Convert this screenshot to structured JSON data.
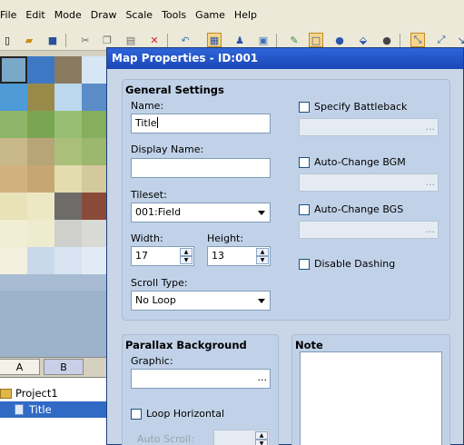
{
  "menu": [
    "File",
    "Edit",
    "Mode",
    "Draw",
    "Scale",
    "Tools",
    "Game",
    "Help"
  ],
  "palette": {
    "tabs": [
      "A",
      "B"
    ]
  },
  "tree": {
    "project": "Project1",
    "map": "Title"
  },
  "dialog": {
    "title": "Map Properties - ID:001",
    "general": {
      "title": "General Settings",
      "name_label": "Name:",
      "name_value": "Title",
      "display_name_label": "Display Name:",
      "display_name_value": "",
      "tileset_label": "Tileset:",
      "tileset_value": "001:Field",
      "width_label": "Width:",
      "width_value": "17",
      "height_label": "Height:",
      "height_value": "13",
      "scroll_type_label": "Scroll Type:",
      "scroll_type_value": "No Loop",
      "specify_battleback": "Specify Battleback",
      "auto_change_bgm": "Auto-Change BGM",
      "auto_change_bgs": "Auto-Change BGS",
      "disable_dashing": "Disable Dashing",
      "ellipsis": "..."
    },
    "parallax": {
      "title": "Parallax Background",
      "graphic_label": "Graphic:",
      "graphic_value": "",
      "loop_horizontal": "Loop Horizontal",
      "auto_scroll_label": "Auto Scroll:",
      "ellipsis": "..."
    },
    "note": {
      "title": "Note",
      "value": ""
    }
  },
  "colors": {
    "titlebar": "#2359d0",
    "dialog_bg": "#c9d6e7",
    "selection": "#316ac5"
  }
}
